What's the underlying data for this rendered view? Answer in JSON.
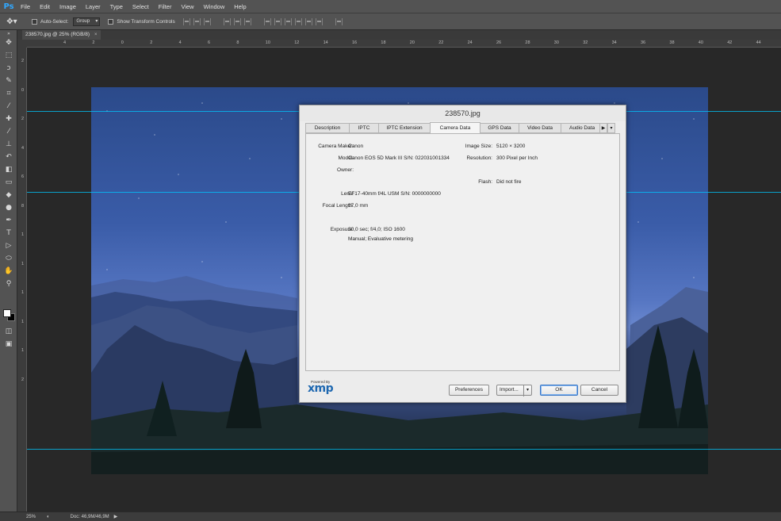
{
  "app": {
    "logo": "Ps",
    "menu": [
      "File",
      "Edit",
      "Image",
      "Layer",
      "Type",
      "Select",
      "Filter",
      "View",
      "Window",
      "Help"
    ]
  },
  "options": {
    "tool_icon": "move-tool-icon",
    "auto_select_label": "Auto-Select:",
    "group_value": "Group",
    "show_transform_label": "Show Transform Controls"
  },
  "document": {
    "tab_title": "238570.jpg @ 25% (RGB/8)",
    "close": "×"
  },
  "ruler": {
    "top_ticks": [
      "4",
      "2",
      "0",
      "2",
      "4",
      "6",
      "8",
      "10",
      "12",
      "14",
      "16",
      "18",
      "20",
      "22",
      "24",
      "26",
      "28",
      "30",
      "32",
      "34",
      "36",
      "38",
      "40",
      "42",
      "44"
    ],
    "left_ticks": [
      "2",
      "0",
      "2",
      "4",
      "6",
      "8",
      "1",
      "1",
      "1",
      "1",
      "1",
      "2"
    ]
  },
  "toolbar": {
    "tools": [
      "move-tool-icon",
      "marquee-tool-icon",
      "lasso-tool-icon",
      "quick-select-icon",
      "crop-tool-icon",
      "eyedropper-icon",
      "healing-brush-icon",
      "brush-tool-icon",
      "clone-stamp-icon",
      "history-brush-icon",
      "eraser-icon",
      "gradient-tool-icon",
      "blur-tool-icon",
      "dodge-tool-icon",
      "pen-tool-icon",
      "type-tool-icon",
      "path-select-icon",
      "ellipse-tool-icon",
      "hand-tool-icon",
      "zoom-tool-icon"
    ],
    "foreground_color": "#ffffff",
    "background_color": "#000000"
  },
  "dialog": {
    "title": "238570.jpg",
    "tabs": [
      "Description",
      "IPTC",
      "IPTC Extension",
      "Camera Data",
      "GPS Data",
      "Video Data",
      "Audio Data"
    ],
    "active_tab": "Camera Data",
    "fields": {
      "camera_maker_label": "Camera Maker:",
      "camera_maker": "Canon",
      "model_label": "Model:",
      "model": "Canon EOS 5D Mark III   S/N: 022031001334",
      "owner_label": "Owner:",
      "owner": "",
      "lens_label": "Lens:",
      "lens": "EF17-40mm f/4L USM   S/N: 0000000000",
      "focal_length_label": "Focal Length:",
      "focal_length": "17,0 mm",
      "exposure_label": "Exposure:",
      "exposure": "30,0 sec;   f/4,0;   ISO 1600",
      "exposure_mode": "Manual;   Evaluative metering",
      "image_size_label": "Image Size:",
      "image_size": "5120 × 3200",
      "resolution_label": "Resolution:",
      "resolution": "300 Pixel per Inch",
      "flash_label": "Flash:",
      "flash": "Did not fire"
    },
    "xmp_powered": "Powered By",
    "xmp_logo": "xmp",
    "buttons": {
      "preferences": "Preferences",
      "import": "Import...",
      "ok": "OK",
      "cancel": "Cancel"
    }
  },
  "status": {
    "zoom": "25%",
    "doc": "Doc: 46,9M/46,9M"
  },
  "colors": {
    "guide": "#00c8ff",
    "accent": "#31a8ff"
  }
}
